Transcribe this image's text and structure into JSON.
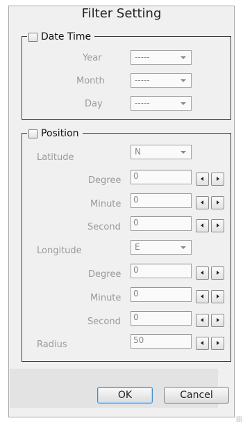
{
  "dialog": {
    "title": "Filter Setting",
    "datetime": {
      "legend": "Date Time",
      "year": {
        "label": "Year",
        "value": "-----"
      },
      "month": {
        "label": "Month",
        "value": "-----"
      },
      "day": {
        "label": "Day",
        "value": "-----"
      }
    },
    "position": {
      "legend": "Position",
      "latitude": {
        "label": "Latitude",
        "hemisphere": "N",
        "degree": {
          "label": "Degree",
          "value": "0"
        },
        "minute": {
          "label": "Minute",
          "value": "0"
        },
        "second": {
          "label": "Second",
          "value": "0"
        }
      },
      "longitude": {
        "label": "Longitude",
        "hemisphere": "E",
        "degree": {
          "label": "Degree",
          "value": "0"
        },
        "minute": {
          "label": "Minute",
          "value": "0"
        },
        "second": {
          "label": "Second",
          "value": "0"
        }
      },
      "radius": {
        "label": "Radius",
        "value": "50"
      }
    },
    "buttons": {
      "ok": "OK",
      "cancel": "Cancel"
    }
  }
}
